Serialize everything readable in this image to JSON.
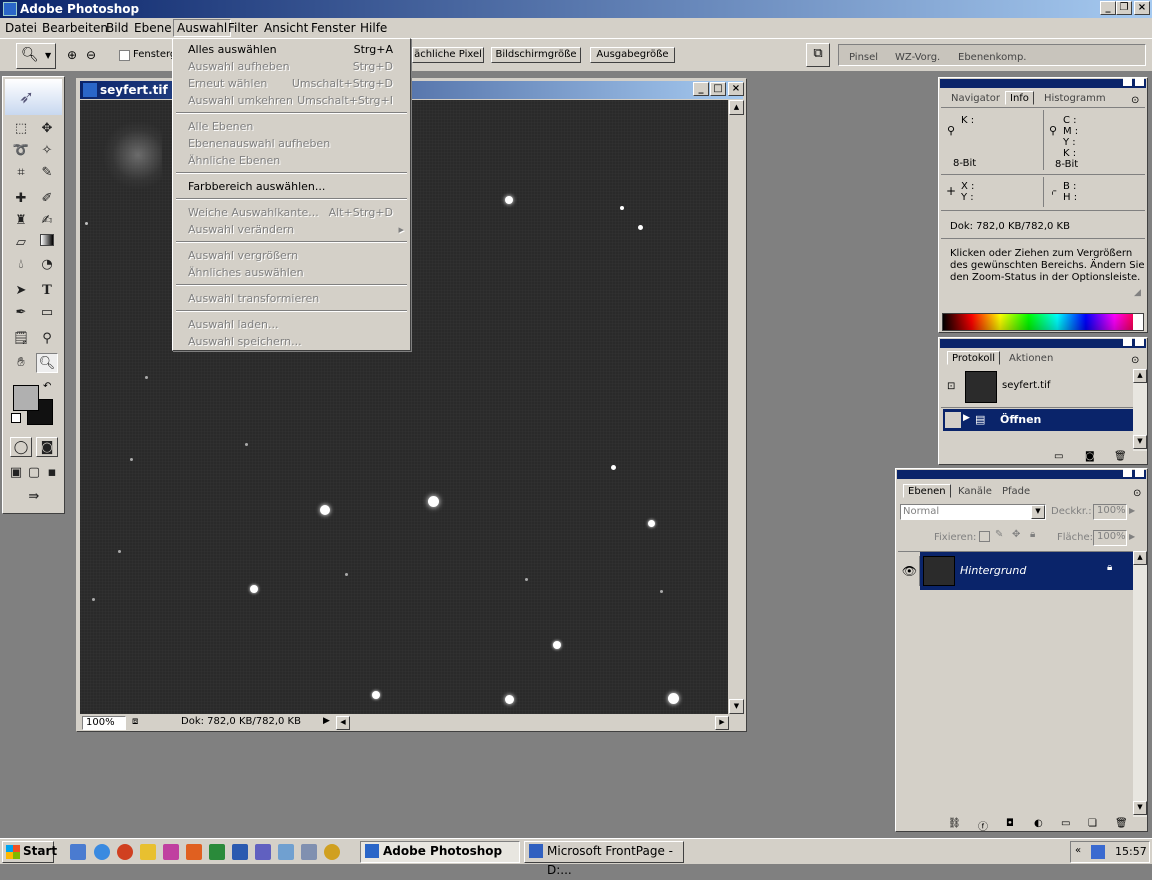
{
  "app": {
    "title": "Adobe Photoshop"
  },
  "menubar": {
    "items": [
      "Datei",
      "Bearbeiten",
      "Bild",
      "Ebene",
      "Auswahl",
      "Filter",
      "Ansicht",
      "Fenster",
      "Hilfe"
    ]
  },
  "options_bar": {
    "fenster_label": "Fensterg",
    "actual_pixels": "ächliche Pixel",
    "fit_screen": "Bildschirmgröße",
    "print_size": "Ausgabegröße",
    "palette_tabs": [
      "Pinsel",
      "WZ-Vorg.",
      "Ebenenkomp."
    ]
  },
  "auswahl_menu": {
    "items": [
      {
        "label": "Alles auswählen",
        "shortcut": "Strg+A",
        "enabled": true
      },
      {
        "label": "Auswahl aufheben",
        "shortcut": "Strg+D",
        "enabled": false
      },
      {
        "label": "Erneut wählen",
        "shortcut": "Umschalt+Strg+D",
        "enabled": false
      },
      {
        "label": "Auswahl umkehren",
        "shortcut": "Umschalt+Strg+I",
        "enabled": false
      },
      {
        "label": "Alle Ebenen",
        "shortcut": "",
        "enabled": false
      },
      {
        "label": "Ebenenauswahl aufheben",
        "shortcut": "",
        "enabled": false
      },
      {
        "label": "Ähnliche Ebenen",
        "shortcut": "",
        "enabled": false
      },
      {
        "label": "Farbbereich auswählen...",
        "shortcut": "",
        "enabled": true
      },
      {
        "label": "Weiche Auswahlkante...",
        "shortcut": "Alt+Strg+D",
        "enabled": false
      },
      {
        "label": "Auswahl verändern",
        "shortcut": "",
        "enabled": false
      },
      {
        "label": "Auswahl vergrößern",
        "shortcut": "",
        "enabled": false
      },
      {
        "label": "Ähnliches auswählen",
        "shortcut": "",
        "enabled": false
      },
      {
        "label": "Auswahl transformieren",
        "shortcut": "",
        "enabled": false
      },
      {
        "label": "Auswahl laden...",
        "shortcut": "",
        "enabled": false
      },
      {
        "label": "Auswahl speichern...",
        "shortcut": "",
        "enabled": false
      }
    ]
  },
  "document": {
    "title": "seyfert.tif @",
    "zoom": "100%",
    "status": "Dok: 782,0 KB/782,0 KB"
  },
  "info_panel": {
    "tabs": [
      "Navigator",
      "Info",
      "Histogramm"
    ],
    "k_label": "K :",
    "c_label": "C :",
    "m_label": "M :",
    "y_label": "Y :",
    "k2_label": "K :",
    "bit_left": "8-Bit",
    "bit_right": "8-Bit",
    "x_label": "X :",
    "y2_label": "Y :",
    "b_label": "B :",
    "h_label": "H :",
    "doc": "Dok: 782,0 KB/782,0 KB",
    "help": "Klicken oder Ziehen zum Vergrößern des gewünschten Bereichs. Ändern Sie den Zoom-Status in der Optionsleiste."
  },
  "history_panel": {
    "tabs": [
      "Protokoll",
      "Aktionen"
    ],
    "snapshot": "seyfert.tif",
    "step": "Öffnen"
  },
  "layers_panel": {
    "tabs": [
      "Ebenen",
      "Kanäle",
      "Pfade"
    ],
    "blend_mode": "Normal",
    "opacity_label": "Deckkr.:",
    "opacity": "100%",
    "lock_label": "Fixieren:",
    "fill_label": "Fläche:",
    "fill": "100%",
    "layer_name": "Hintergrund"
  },
  "taskbar": {
    "start": "Start",
    "tasks": [
      "Adobe Photoshop",
      "Microsoft FrontPage - D:..."
    ],
    "time": "15:57"
  },
  "colors": {
    "titlebar": "#0a246a",
    "selection": "#0a246a",
    "chrome": "#d4d0c8",
    "canvas": "#2a2a2a"
  }
}
